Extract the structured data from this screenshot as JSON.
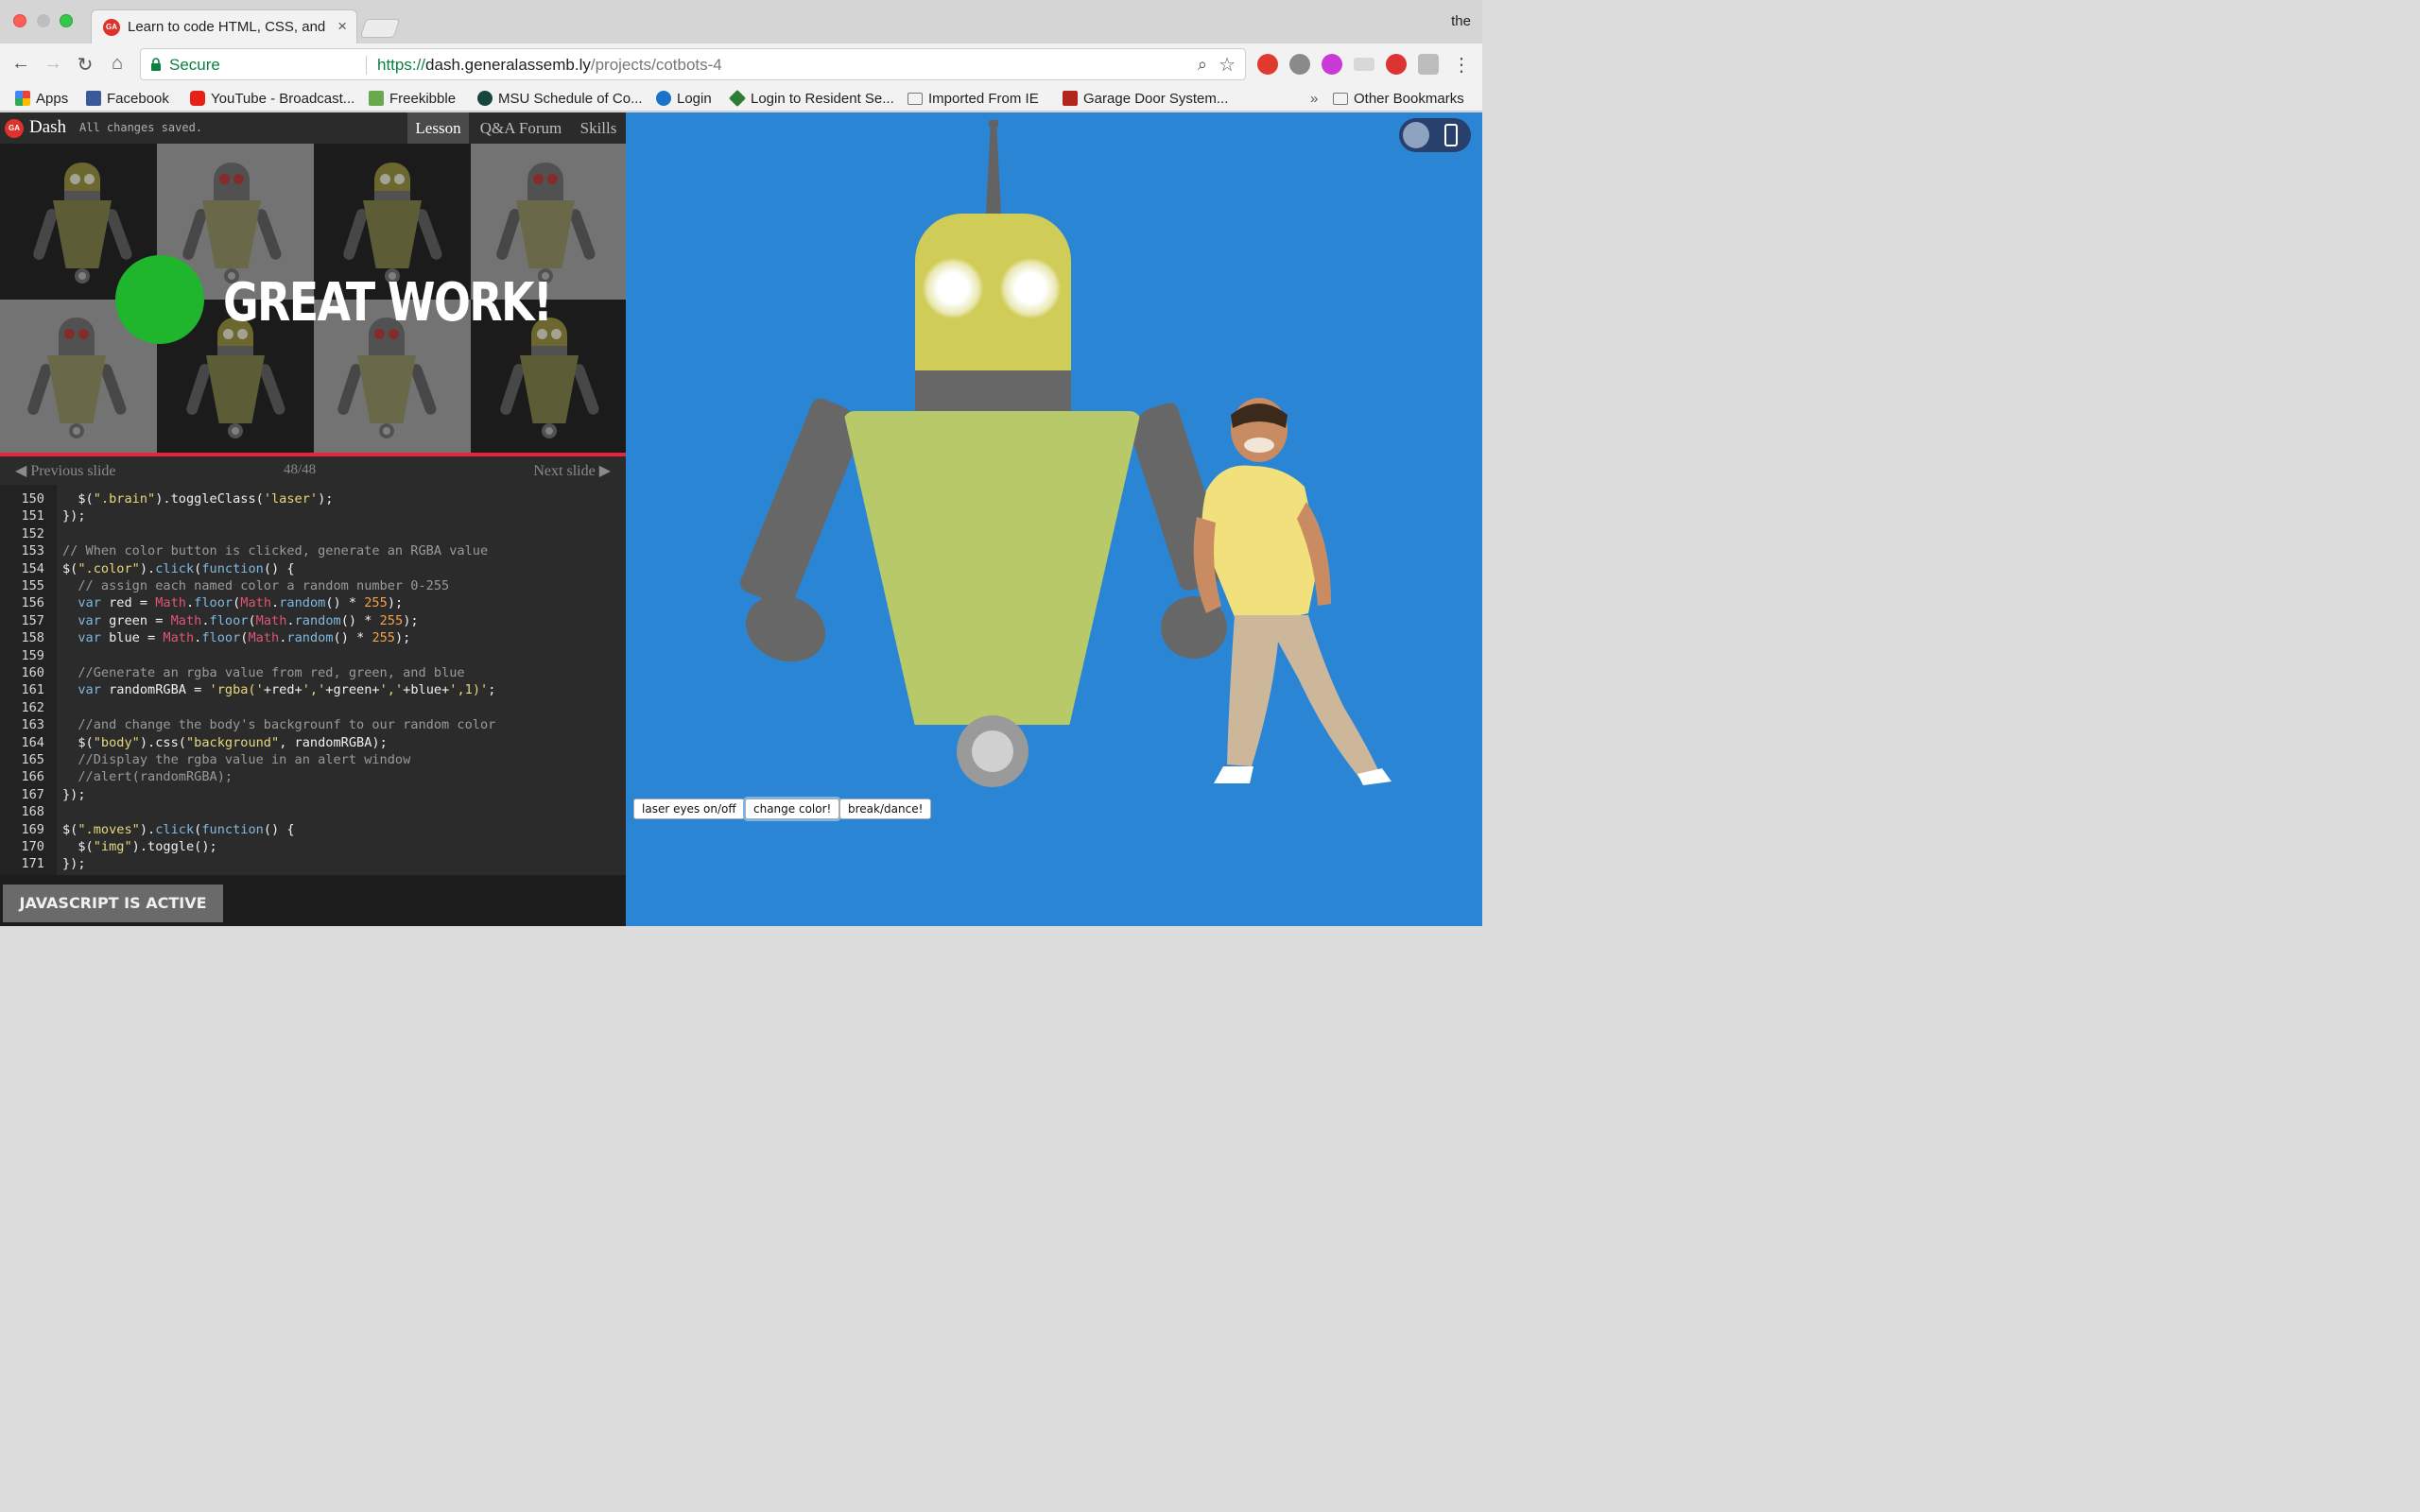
{
  "browser": {
    "tab_title": "Learn to code HTML, CSS, and",
    "tab_favicon": "GA",
    "profile_name": "the",
    "omnibox": {
      "secure_label": "Secure",
      "url_scheme": "https://",
      "url_host": "dash.generalassemb.ly",
      "url_path": "/projects/cotbots-4"
    },
    "bookmarks": [
      {
        "label": "Apps",
        "icon": "apps-grid-icon",
        "color": "#4285f4"
      },
      {
        "label": "Facebook",
        "icon": "facebook-icon",
        "color": "#3b5998"
      },
      {
        "label": "YouTube - Broadcast...",
        "icon": "youtube-icon",
        "color": "#e62117"
      },
      {
        "label": "Freekibble",
        "icon": "freekibble-icon",
        "color": "#6aa84f"
      },
      {
        "label": "MSU Schedule of Co...",
        "icon": "msu-spartan-icon",
        "color": "#18453b"
      },
      {
        "label": "Login",
        "icon": "pearson-icon",
        "color": "#1a73c9"
      },
      {
        "label": "Login to Resident Se...",
        "icon": "resident-icon",
        "color": "#2e7d32"
      },
      {
        "label": "Imported From IE",
        "icon": "folder-icon",
        "color": "#888888"
      },
      {
        "label": "Garage Door System...",
        "icon": "garage-icon",
        "color": "#b3261e"
      }
    ],
    "bookmarks_overflow": "»",
    "other_bookmarks": "Other Bookmarks"
  },
  "dash": {
    "title": "Dash",
    "logo": "GA",
    "save_status": "All changes saved.",
    "tabs": [
      "Lesson",
      "Q&A Forum",
      "Skills"
    ],
    "active_tab": "Lesson",
    "slide": {
      "headline": "GREAT WORK!",
      "accent_color": "#1fb52c",
      "progress_color": "#e8253a",
      "progress": 1.0
    },
    "slide_nav": {
      "prev_label": "Previous slide",
      "counter": "48/48",
      "next_label": "Next slide"
    },
    "code_lines": [
      {
        "n": "150",
        "t": "  $(\".brain\").toggleClass('laser');"
      },
      {
        "n": "151",
        "t": "});"
      },
      {
        "n": "152",
        "t": ""
      },
      {
        "n": "153",
        "t": "// When color button is clicked, generate an RGBA value"
      },
      {
        "n": "154",
        "t": "$(\".color\").click(function() {"
      },
      {
        "n": "155",
        "t": "  // assign each named color a random number 0-255"
      },
      {
        "n": "156",
        "t": "  var red = Math.floor(Math.random() * 255);"
      },
      {
        "n": "157",
        "t": "  var green = Math.floor(Math.random() * 255);"
      },
      {
        "n": "158",
        "t": "  var blue = Math.floor(Math.random() * 255);"
      },
      {
        "n": "159",
        "t": ""
      },
      {
        "n": "160",
        "t": "  //Generate an rgba value from red, green, and blue"
      },
      {
        "n": "161",
        "t": "  var randomRGBA = 'rgba('+red+','+green+','+blue+',1)';"
      },
      {
        "n": "162",
        "t": ""
      },
      {
        "n": "163",
        "t": "  //and change the body's backgrounf to our random color"
      },
      {
        "n": "164",
        "t": "  $(\"body\").css(\"background\", randomRGBA);"
      },
      {
        "n": "165",
        "t": "  //Display the rgba value in an alert window"
      },
      {
        "n": "166",
        "t": "  //alert(randomRGBA);"
      },
      {
        "n": "167",
        "t": "});"
      },
      {
        "n": "168",
        "t": ""
      },
      {
        "n": "169",
        "t": "$(\".moves\").click(function() {"
      },
      {
        "n": "170",
        "t": "  $(\"img\").toggle();"
      },
      {
        "n": "171",
        "t": "});"
      }
    ],
    "footer_button": "JAVASCRIPT IS ACTIVE"
  },
  "preview": {
    "background_color": "#2a85d4",
    "robot_head_color": "#cfcc57",
    "robot_body_color": "#b8c96a",
    "robot_metal_color": "#676767",
    "buttons": [
      "laser eyes on/off",
      "change color!",
      "break/dance!"
    ]
  }
}
